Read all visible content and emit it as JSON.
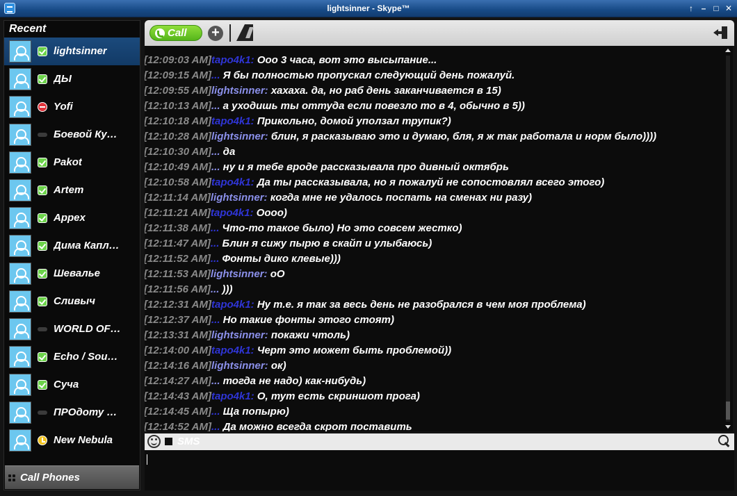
{
  "window": {
    "title": "lightsinner - Skype™"
  },
  "sidebar": {
    "recent_label": "Recent",
    "contacts": [
      {
        "name": "lightsinner",
        "status": "online",
        "selected": true
      },
      {
        "name": "ДЫ",
        "status": "online"
      },
      {
        "name": "Yofi",
        "status": "dnd"
      },
      {
        "name": "Боевой Ку…",
        "status": "offline"
      },
      {
        "name": "Pakot",
        "status": "online"
      },
      {
        "name": "Artem",
        "status": "online"
      },
      {
        "name": "Appex",
        "status": "online"
      },
      {
        "name": "Дима Капл…",
        "status": "online"
      },
      {
        "name": "Шевалье",
        "status": "online"
      },
      {
        "name": "Сливыч",
        "status": "online"
      },
      {
        "name": "WORLD OF…",
        "status": "offline"
      },
      {
        "name": "Echo / Sou…",
        "status": "online"
      },
      {
        "name": "Суча",
        "status": "online"
      },
      {
        "name": "ПРОдоту …",
        "status": "offline"
      },
      {
        "name": "New Nebula",
        "status": "away"
      }
    ],
    "call_phones_label": "Call Phones"
  },
  "toolbar": {
    "call_label": "Call"
  },
  "input": {
    "sms_label": "SMS"
  },
  "messages": [
    {
      "ts": "",
      "nick": "",
      "text": "",
      "cut": true
    },
    {
      "ts": "[12:09:03 AM]",
      "nick": "tapo4k1:",
      "me": false,
      "text": "Ооо 3 часа, вот это высыпание..."
    },
    {
      "ts": "[12:09:15 AM]",
      "nick": "...",
      "me": false,
      "text": "Я бы полностью пропускал следующий день пожалуй."
    },
    {
      "ts": "[12:09:55 AM]",
      "nick": "lightsinner:",
      "me": true,
      "text": "хахаха. да, но раб день заканчивается в 15)"
    },
    {
      "ts": "[12:10:13 AM]",
      "nick": "...",
      "me": true,
      "text": "а уходишь ты оттуда если повезло то в 4, обычно в 5))"
    },
    {
      "ts": "[12:10:18 AM]",
      "nick": "tapo4k1:",
      "me": false,
      "text": "Прикольно, домой уползал трупик?)"
    },
    {
      "ts": "[12:10:28 AM]",
      "nick": "lightsinner:",
      "me": true,
      "text": "блин, я расказываю это и думаю, бля, я ж так работала и норм было))))"
    },
    {
      "ts": "[12:10:30 AM]",
      "nick": "...",
      "me": true,
      "text": "да"
    },
    {
      "ts": "[12:10:49 AM]",
      "nick": "...",
      "me": true,
      "text": "ну и я тебе вроде рассказывала про дивный октябрь"
    },
    {
      "ts": "[12:10:58 AM]",
      "nick": "tapo4k1:",
      "me": false,
      "text": "Да ты рассказывала, но я пожалуй не сопостовлял всего этого)"
    },
    {
      "ts": "[12:11:14 AM]",
      "nick": "lightsinner:",
      "me": true,
      "text": "когда мне не удалось поспать на сменах ни разу)"
    },
    {
      "ts": "[12:11:21 AM]",
      "nick": "tapo4k1:",
      "me": false,
      "text": "Оооо)"
    },
    {
      "ts": "[12:11:38 AM]",
      "nick": "...",
      "me": false,
      "text": "Что-то такое было) Но это совсем жестко)"
    },
    {
      "ts": "[12:11:47 AM]",
      "nick": "...",
      "me": false,
      "text": "Блин я сижу пырю в скайп и улыбаюсь)"
    },
    {
      "ts": "[12:11:52 AM]",
      "nick": "...",
      "me": false,
      "text": "Фонты дико клевые)))"
    },
    {
      "ts": "[12:11:53 AM]",
      "nick": "lightsinner:",
      "me": true,
      "text": "оО"
    },
    {
      "ts": "[12:11:56 AM]",
      "nick": "...",
      "me": true,
      "text": ")))"
    },
    {
      "ts": "[12:12:31 AM]",
      "nick": "tapo4k1:",
      "me": false,
      "text": "Ну т.е. я так за весь день не разобрался в чем моя проблема)"
    },
    {
      "ts": "[12:12:37 AM]",
      "nick": "...",
      "me": false,
      "text": "Но такие фонты этого стоят)"
    },
    {
      "ts": "[12:13:31 AM]",
      "nick": "lightsinner:",
      "me": true,
      "text": "покажи чтоль)"
    },
    {
      "ts": "[12:14:00 AM]",
      "nick": "tapo4k1:",
      "me": false,
      "text": "Черт это может быть проблемой))"
    },
    {
      "ts": "[12:14:16 AM]",
      "nick": "lightsinner:",
      "me": true,
      "text": "ок)"
    },
    {
      "ts": "[12:14:27 AM]",
      "nick": "...",
      "me": true,
      "text": "тогда не надо) как-нибудь)"
    },
    {
      "ts": "[12:14:43 AM]",
      "nick": "tapo4k1:",
      "me": false,
      "text": "О, тут есть скриншот прога)"
    },
    {
      "ts": "[12:14:45 AM]",
      "nick": "...",
      "me": false,
      "text": "Ща попырю)"
    },
    {
      "ts": "[12:14:52 AM]",
      "nick": "...",
      "me": false,
      "text": "Да можно всегда скрот поставить"
    }
  ]
}
